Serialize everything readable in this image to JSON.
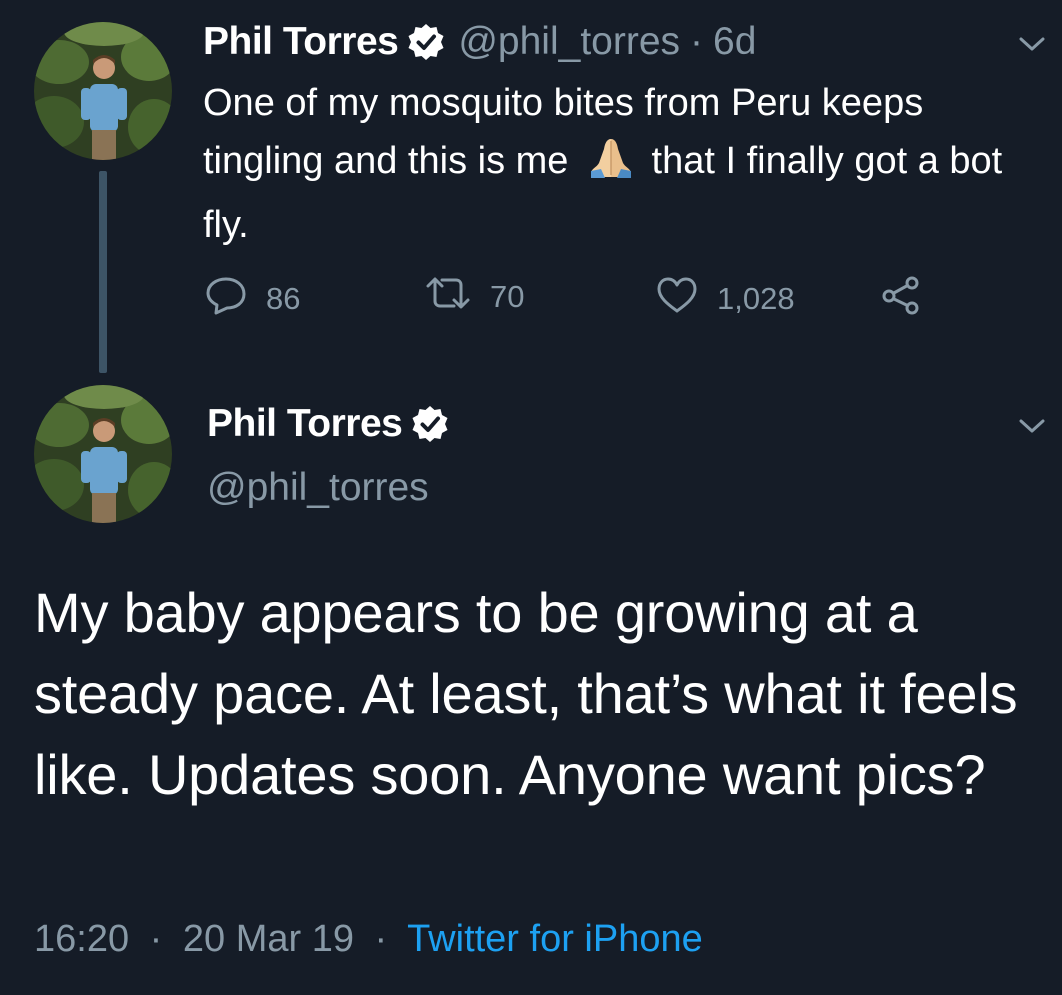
{
  "tweet1": {
    "name": "Phil Torres",
    "handle": "@phil_torres",
    "separator": "·",
    "age": "6d",
    "text_part1": "One of my mosquito bites from Peru keeps tingling and this is me",
    "emoji": "folded-hands-emoji",
    "text_part2": "that I finally got a bot fly.",
    "replies": "86",
    "retweets": "70",
    "likes": "1,028"
  },
  "tweet2": {
    "name": "Phil Torres",
    "handle": "@phil_torres",
    "text": "My baby appears to be growing at a steady pace. At least, that’s what it feels like. Updates soon. Anyone want pics?",
    "time": "16:20",
    "dot1": "·",
    "date": "20 Mar 19",
    "dot2": "·",
    "source": "Twitter for iPhone"
  },
  "colors": {
    "background": "#151c27",
    "text": "#ffffff",
    "secondary": "#8899a6",
    "link": "#1da1f2",
    "thread_line": "#3d5466"
  },
  "icons": [
    "chevron-down-icon",
    "verified-badge-icon",
    "reply-icon",
    "retweet-icon",
    "like-icon",
    "share-icon"
  ]
}
